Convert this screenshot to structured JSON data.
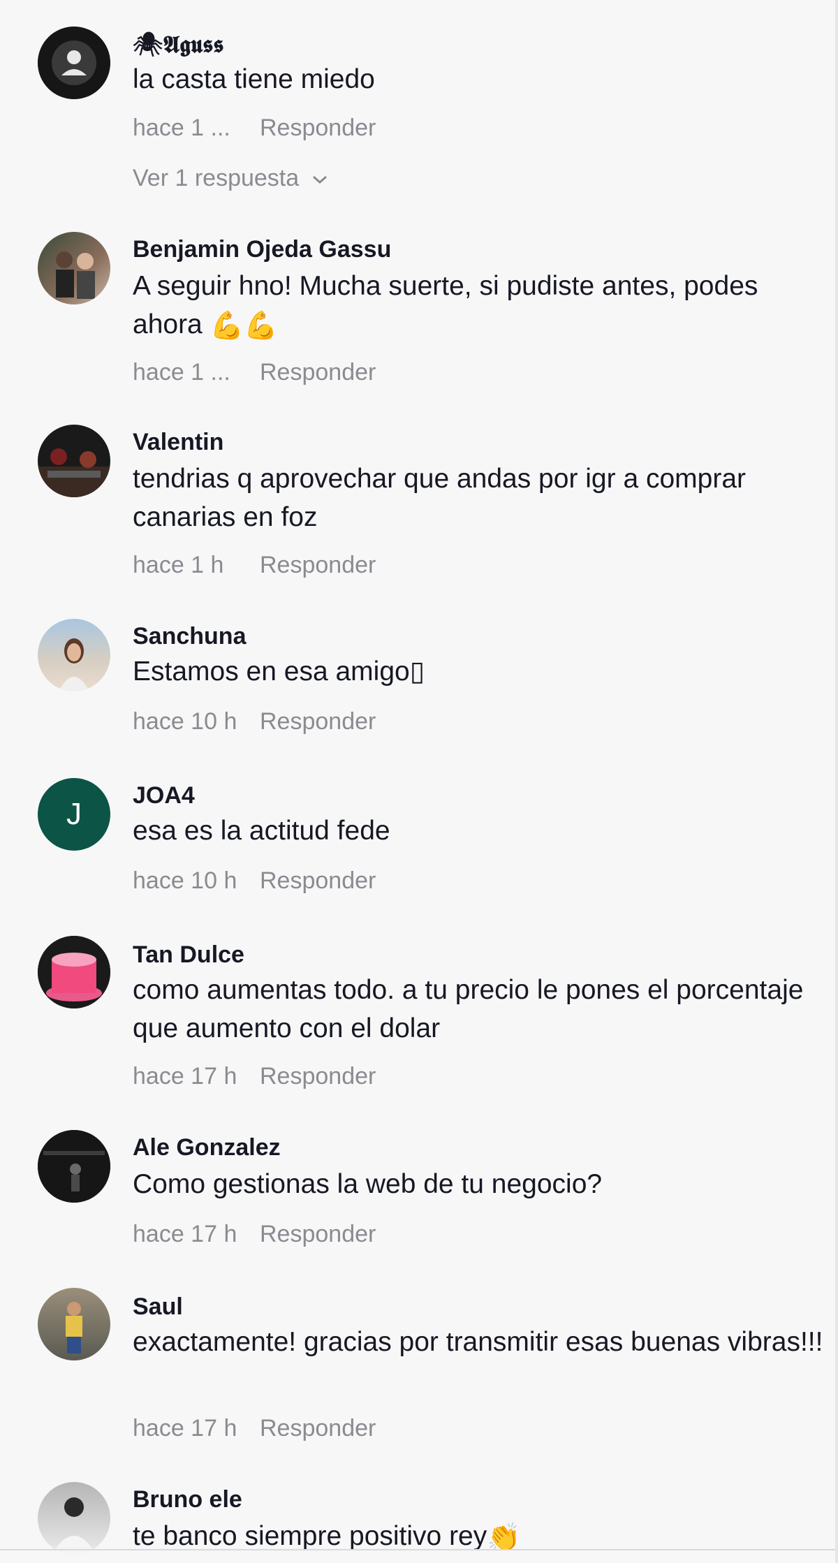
{
  "comments": [
    {
      "username": "🕷𝕬𝖌𝖚𝖘𝖘",
      "text": "la casta tiene miedo",
      "time": "hace 1 ...",
      "reply": "Responder",
      "view_replies": "Ver 1 respuesta",
      "avatar_icon": "default-user-icon"
    },
    {
      "username": "Benjamin Ojeda Gassu",
      "text": "A seguir hno! Mucha suerte, si pudiste antes, podes ahora",
      "emoji": "💪💪",
      "time": "hace 1 ...",
      "reply": "Responder",
      "avatar_icon": "photo-avatar"
    },
    {
      "username": "Valentin",
      "text": "tendrias q aprovechar que andas por igr a comprar canarias en foz",
      "time": "hace 1 h",
      "reply": "Responder",
      "avatar_icon": "photo-avatar"
    },
    {
      "username": "Sanchuna",
      "text": "Estamos en esa amigo",
      "missing_glyph": "▯",
      "time": "hace 10 h",
      "reply": "Responder",
      "avatar_icon": "photo-avatar"
    },
    {
      "username": "JOA4",
      "text": "esa es la actitud fede",
      "time": "hace 10 h",
      "reply": "Responder",
      "avatar_letter": "J",
      "avatar_color": "#0b5446"
    },
    {
      "username": "Tan Dulce",
      "text": "como aumentas todo. a tu precio le pones el porcentaje que aumento con el dolar",
      "time": "hace 17 h",
      "reply": "Responder",
      "avatar_icon": "cake-avatar"
    },
    {
      "username": "Ale Gonzalez",
      "text": "Como gestionas la web de tu negocio?",
      "time": "hace 17 h",
      "reply": "Responder",
      "avatar_icon": "photo-avatar"
    },
    {
      "username": "Saul",
      "text": "exactamente! gracias por transmitir esas buenas vibras!!!",
      "time": "hace 17 h",
      "reply": "Responder",
      "avatar_icon": "photo-avatar"
    },
    {
      "username": "Bruno ele",
      "text": "te banco siempre positivo rey",
      "emoji": "👏",
      "avatar_icon": "photo-avatar"
    }
  ]
}
